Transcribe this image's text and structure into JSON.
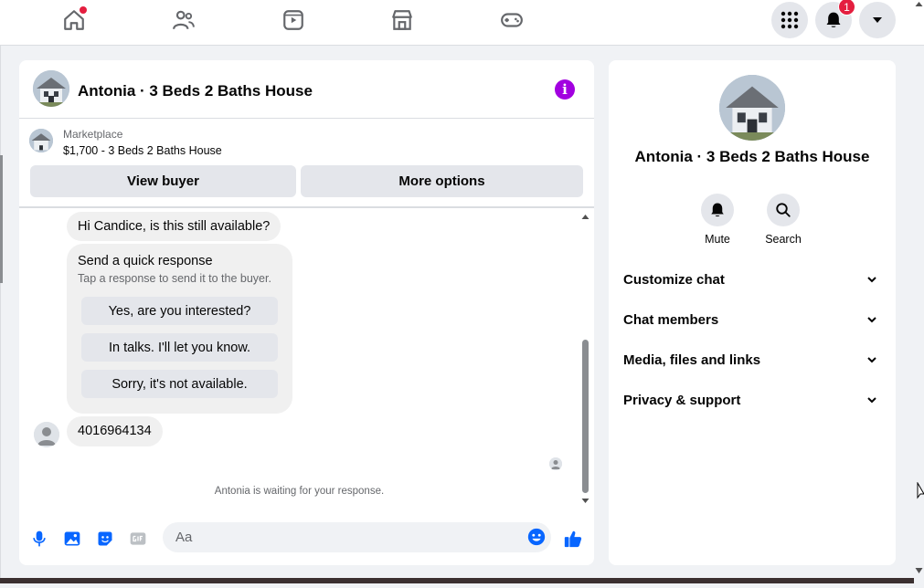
{
  "topbar": {
    "nav": [
      "home-icon",
      "friends-icon",
      "watch-icon",
      "marketplace-icon",
      "gaming-icon"
    ],
    "notifications_count": "1"
  },
  "chat": {
    "title": "Antonia · 3 Beds 2 Baths House",
    "marketplace_label": "Marketplace",
    "listing": "$1,700 - 3 Beds 2 Baths House",
    "view_buyer_label": "View buyer",
    "more_options_label": "More options",
    "messages": {
      "first": "Hi Candice, is this still available?",
      "phone": "4016964134"
    },
    "quick_response": {
      "title": "Send a quick response",
      "subtitle": "Tap a response to send it to the buyer.",
      "options": [
        "Yes, are you interested?",
        "In talks. I'll let you know.",
        "Sorry, it's not available."
      ]
    },
    "waiting": "Antonia is waiting for your response.",
    "composer_placeholder": "Aa"
  },
  "side": {
    "name": "Antonia · 3 Beds 2 Baths House",
    "actions": [
      "Mute",
      "Search"
    ],
    "sections": [
      "Customize chat",
      "Chat members",
      "Media, files and links",
      "Privacy & support"
    ]
  },
  "colors": {
    "accent": "#0866ff",
    "info": "#a200e0",
    "badge": "#e41e3f"
  }
}
